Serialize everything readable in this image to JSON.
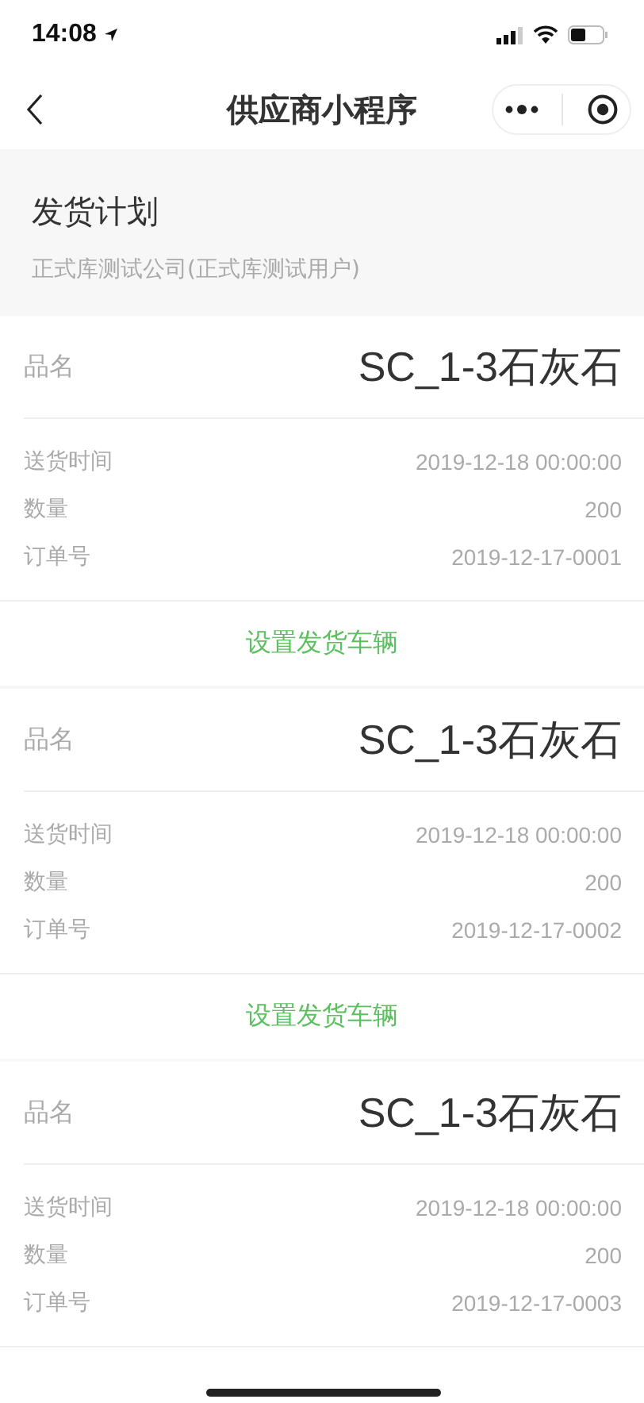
{
  "status_bar": {
    "time": "14:08"
  },
  "nav": {
    "title": "供应商小程序"
  },
  "header": {
    "title": "发货计划",
    "subtitle": "正式库测试公司(正式库测试用户)"
  },
  "plans": [
    {
      "name_label": "品名",
      "name": "SC_1-3石灰石",
      "fields": [
        {
          "label": "送货时间",
          "value": "2019-12-18 00:00:00"
        },
        {
          "label": "数量",
          "value": "200"
        },
        {
          "label": "订单号",
          "value": "2019-12-17-0001"
        }
      ],
      "action": "设置发货车辆"
    },
    {
      "name_label": "品名",
      "name": "SC_1-3石灰石",
      "fields": [
        {
          "label": "送货时间",
          "value": "2019-12-18 00:00:00"
        },
        {
          "label": "数量",
          "value": "200"
        },
        {
          "label": "订单号",
          "value": "2019-12-17-0002"
        }
      ],
      "action": "设置发货车辆"
    },
    {
      "name_label": "品名",
      "name": "SC_1-3石灰石",
      "fields": [
        {
          "label": "送货时间",
          "value": "2019-12-18 00:00:00"
        },
        {
          "label": "数量",
          "value": "200"
        },
        {
          "label": "订单号",
          "value": "2019-12-17-0003"
        }
      ]
    }
  ]
}
